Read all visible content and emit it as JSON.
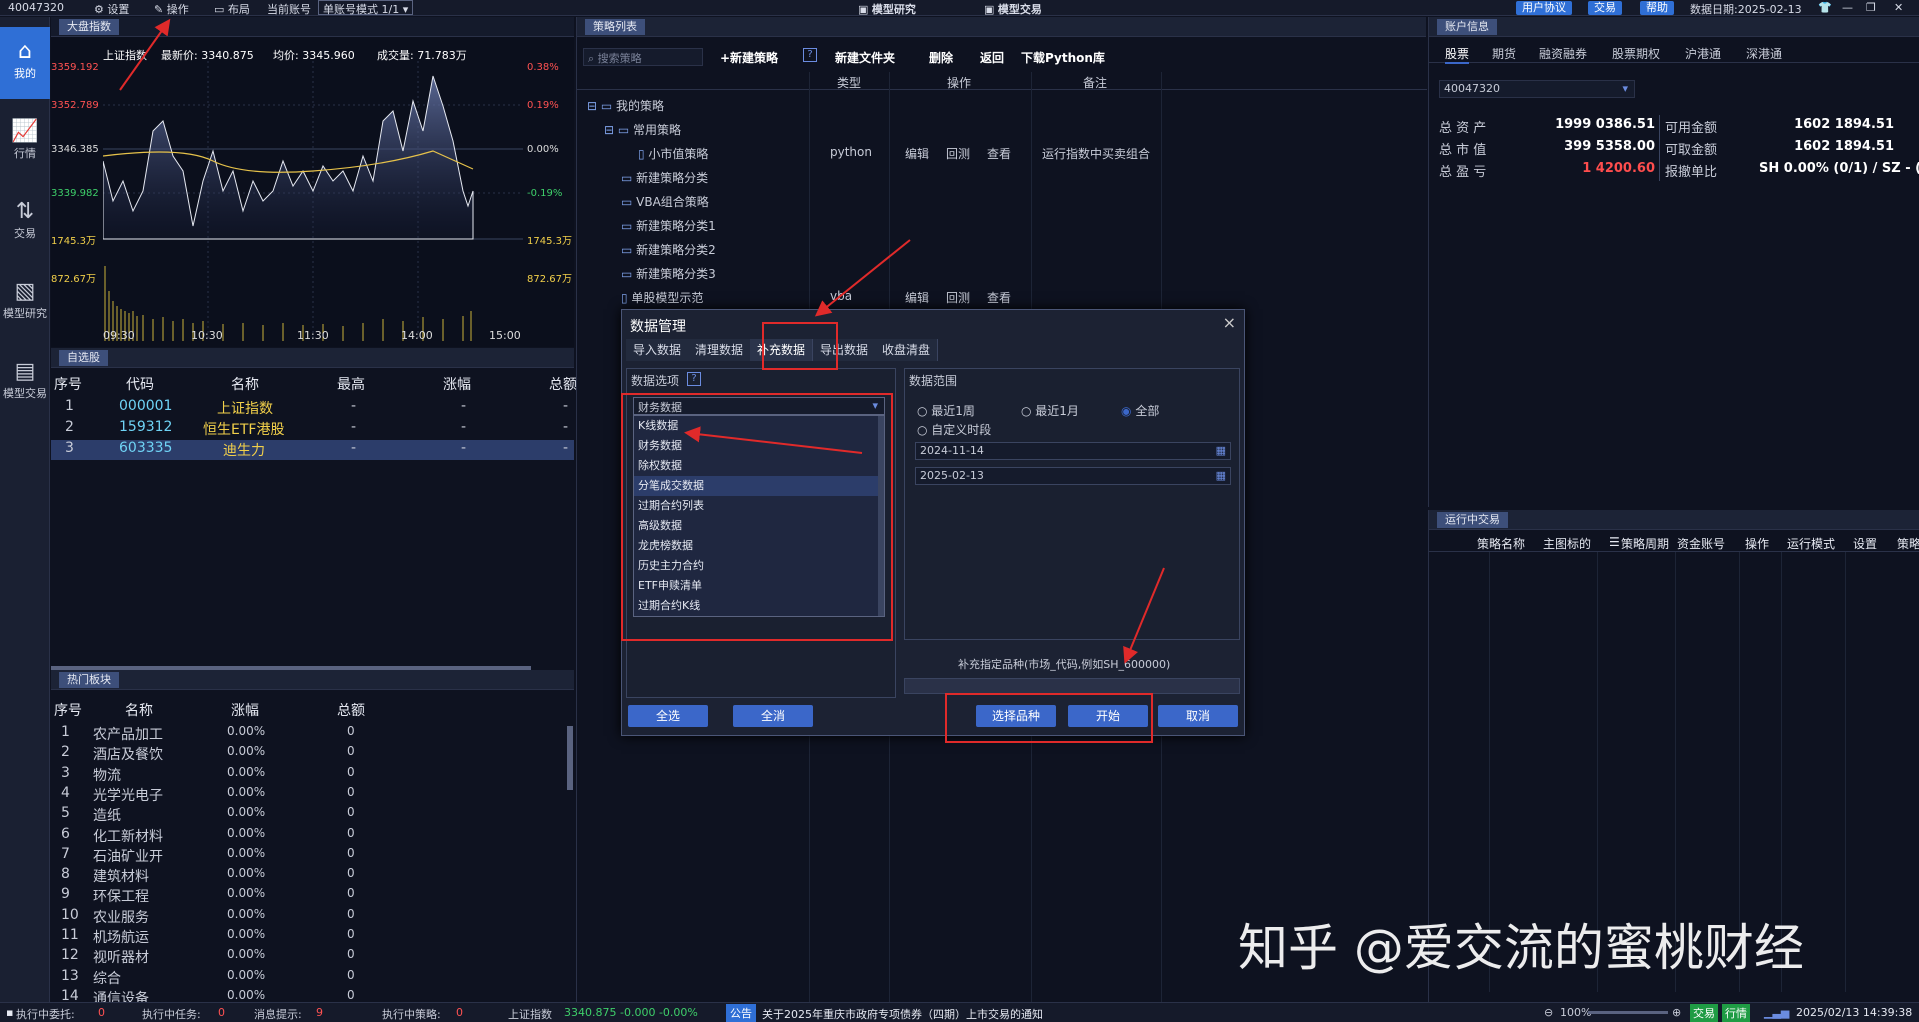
{
  "topbar": {
    "account_id": "40047320",
    "settings": "设置",
    "operate": "操作",
    "layout": "布局",
    "current_account": "当前账号",
    "account_mode": "单账号模式 1/1",
    "model_research": "模型研究",
    "model_trade": "模型交易",
    "user_agreement": "用户协议",
    "trade": "交易",
    "help": "帮助",
    "data_date": "数据日期:2025-02-13"
  },
  "sidebar": [
    {
      "label": "我的",
      "icon": "home-icon"
    },
    {
      "label": "行情",
      "icon": "chart-icon"
    },
    {
      "label": "交易",
      "icon": "exchange-icon"
    },
    {
      "label": "模型研究",
      "icon": "research-icon"
    },
    {
      "label": "模型交易",
      "icon": "model-trade-icon"
    }
  ],
  "index_panel": {
    "title": "大盘指数",
    "name": "上证指数",
    "latest": "最新价: 3340.875",
    "avg": "均价: 3345.960",
    "volume": "成交量: 71.783万",
    "y_left": [
      "3359.192",
      "3352.789",
      "3346.385",
      "3339.982",
      "1745.3万",
      "872.67万"
    ],
    "y_right": [
      "0.38%",
      "0.19%",
      "0.00%",
      "-0.19%",
      "1745.3万",
      "872.67万"
    ],
    "x_ticks": [
      "09:30",
      "10:30",
      "11:30",
      "14:00",
      "15:00"
    ]
  },
  "watchlist": {
    "title": "自选股",
    "headers": [
      "序号",
      "代码",
      "名称",
      "最高",
      "涨幅",
      "总额"
    ],
    "rows": [
      [
        "1",
        "000001",
        "上证指数",
        "-",
        "-",
        "-"
      ],
      [
        "2",
        "159312",
        "恒生ETF港股",
        "-",
        "-",
        "-"
      ],
      [
        "3",
        "603335",
        "迪生力",
        "-",
        "-",
        "-"
      ]
    ]
  },
  "hot": {
    "title": "热门板块",
    "headers": [
      "序号",
      "名称",
      "涨幅",
      "总额"
    ],
    "rows": [
      [
        "1",
        "农产品加工",
        "0.00%",
        "0"
      ],
      [
        "2",
        "酒店及餐饮",
        "0.00%",
        "0"
      ],
      [
        "3",
        "物流",
        "0.00%",
        "0"
      ],
      [
        "4",
        "光学光电子",
        "0.00%",
        "0"
      ],
      [
        "5",
        "造纸",
        "0.00%",
        "0"
      ],
      [
        "6",
        "化工新材料",
        "0.00%",
        "0"
      ],
      [
        "7",
        "石油矿业开",
        "0.00%",
        "0"
      ],
      [
        "8",
        "建筑材料",
        "0.00%",
        "0"
      ],
      [
        "9",
        "环保工程",
        "0.00%",
        "0"
      ],
      [
        "10",
        "农业服务",
        "0.00%",
        "0"
      ],
      [
        "11",
        "机场航运",
        "0.00%",
        "0"
      ],
      [
        "12",
        "视听器材",
        "0.00%",
        "0"
      ],
      [
        "13",
        "综合",
        "0.00%",
        "0"
      ],
      [
        "14",
        "通信设备",
        "0.00%",
        "0"
      ]
    ]
  },
  "strategy": {
    "title": "策略列表",
    "search_placeholder": "搜索策略",
    "new_strategy": "+新建策略",
    "help_q": "?",
    "new_folder": "新建文件夹",
    "delete": "删除",
    "back": "返回",
    "download": "下载Python库",
    "headers": [
      "类型",
      "操作",
      "备注"
    ],
    "tree": [
      {
        "label": "我的策略",
        "indent": 0
      },
      {
        "label": "常用策略",
        "indent": 1
      },
      {
        "label": "小市值策略",
        "indent": 3,
        "type": "python",
        "ops": [
          "编辑",
          "回测",
          "查看"
        ],
        "note": "运行指数中买卖组合"
      },
      {
        "label": "新建策略分类",
        "indent": 2
      },
      {
        "label": "VBA组合策略",
        "indent": 2
      },
      {
        "label": "新建策略分类1",
        "indent": 2
      },
      {
        "label": "新建策略分类2",
        "indent": 2
      },
      {
        "label": "新建策略分类3",
        "indent": 2
      },
      {
        "label": "单股模型示范",
        "indent": 2,
        "type": "vba",
        "ops": [
          "编辑",
          "回测",
          "查看"
        ],
        "note": ""
      }
    ]
  },
  "account": {
    "title": "账户信息",
    "tabs": [
      "股票",
      "期货",
      "融资融券",
      "股票期权",
      "沪港通",
      "深港通"
    ],
    "account_select": "40047320",
    "rows": [
      [
        "总 资 产",
        "1999 0386.51",
        "可用金额",
        "1602 1894.51"
      ],
      [
        "总 市 值",
        "399 5358.00",
        "可取金额",
        "1602 1894.51"
      ],
      [
        "总 盈 亏",
        "1 4200.60",
        "报撤单比",
        "SH 0.00% (0/1) / SZ - (0/0)"
      ]
    ]
  },
  "running": {
    "title": "运行中交易",
    "headers": [
      "策略名称",
      "主图标的",
      "策略周期",
      "资金账号",
      "操作",
      "运行模式",
      "设置",
      "策略"
    ]
  },
  "dialog": {
    "title": "数据管理",
    "close": "×",
    "tabs": [
      "导入数据",
      "清理数据",
      "补充数据",
      "导出数据",
      "收盘清盘"
    ],
    "options_title": "数据选项",
    "help_q": "?",
    "select_value": "财务数据",
    "options": [
      "K线数据",
      "财务数据",
      "除权数据",
      "分笔成交数据",
      "过期合约列表",
      "高级数据",
      "龙虎榜数据",
      "历史主力合约",
      "ETF申赎清单",
      "过期合约K线"
    ],
    "range_title": "数据范围",
    "range": [
      "最近1周",
      "最近1月",
      "全部",
      "自定义时段"
    ],
    "date_start": "2024-11-14",
    "date_end": "2025-02-13",
    "supplement_label": "补充指定品种(市场_代码,例如SH_600000)",
    "select_all": "全选",
    "clear_all": "全消",
    "choose_symbol": "选择品种",
    "start": "开始",
    "cancel": "取消"
  },
  "watermark": "知乎 @爱交流的蜜桃财经",
  "statusbar": {
    "exec_order": "执行中委托:",
    "exec_order_n": "0",
    "exec_task": "执行中任务:",
    "exec_task_n": "0",
    "msg": "消息提示:",
    "msg_n": "9",
    "exec_strategy": "执行中策略:",
    "exec_strategy_n": "0",
    "index": "上证指数",
    "index_vals": "3340.875 -0.000 -0.00%",
    "notice_tag": "公告",
    "notice": "关于2025年重庆市政府专项债券（四期）上市交易的通知",
    "zoom": "100%",
    "trade": "交易",
    "quote": "行情",
    "datetime": "2025/02/13 14:39:38"
  }
}
